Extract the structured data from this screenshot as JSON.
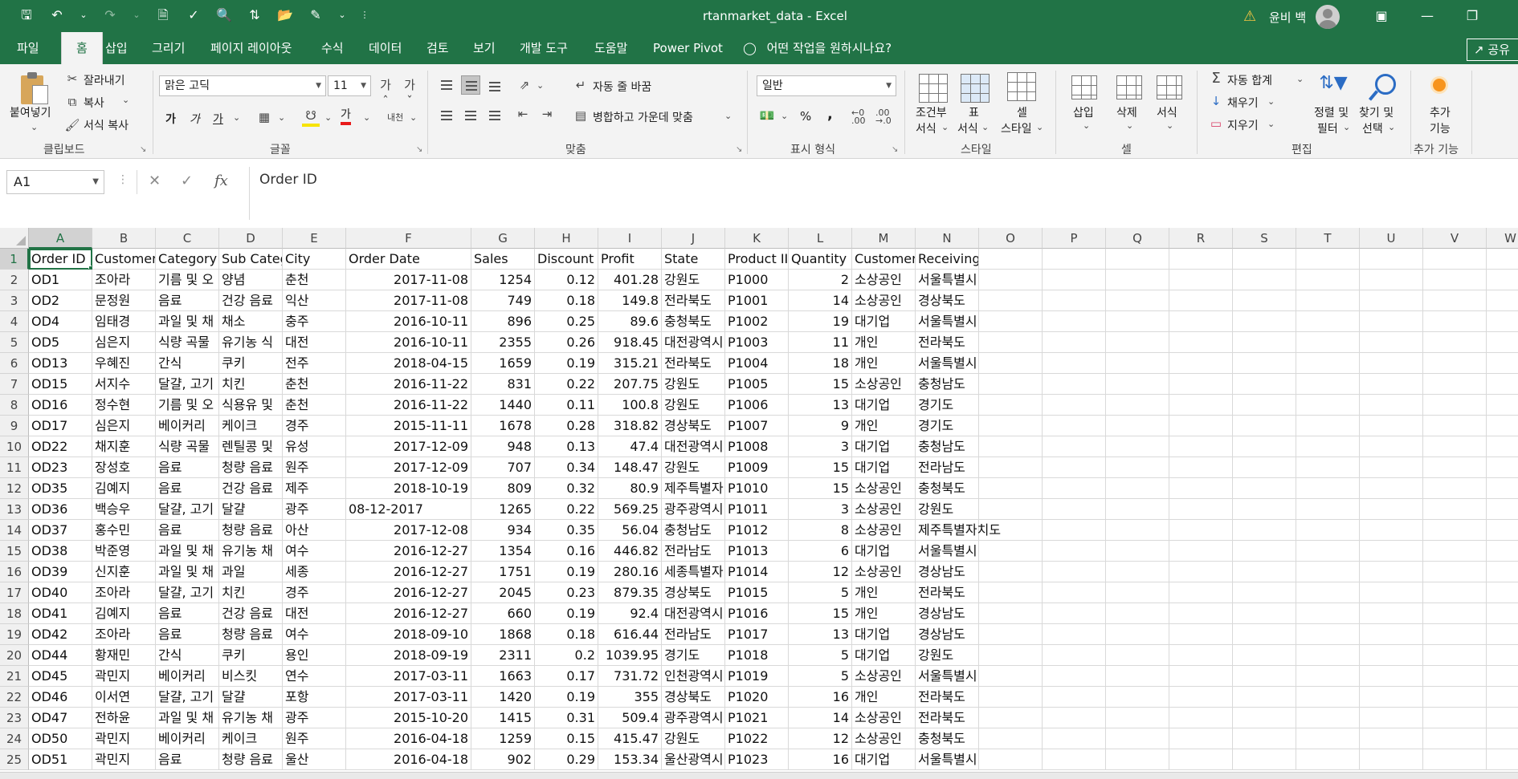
{
  "window": {
    "title": "rtanmarket_data  -  Excel",
    "user_name": "윤비 백"
  },
  "menu": {
    "tabs": [
      "파일",
      "홈",
      "삽입",
      "그리기",
      "페이지 레이아웃",
      "수식",
      "데이터",
      "검토",
      "보기",
      "개발 도구",
      "도움말",
      "Power Pivot"
    ],
    "active_tab": "홈",
    "tell_me": "어떤 작업을 원하시나요?",
    "share": "공유"
  },
  "ribbon": {
    "clipboard": {
      "paste": "붙여넣기",
      "cut": "잘라내기",
      "copy": "복사",
      "format_painter": "서식 복사",
      "group": "클립보드"
    },
    "font": {
      "name": "맑은 고딕",
      "size": "11",
      "bold": "가",
      "italic": "가",
      "underline": "가",
      "font_color_glyph": "가",
      "phonetic": "내천",
      "group": "글꼴"
    },
    "alignment": {
      "wrap_text": "자동 줄 바꿈",
      "merge_center": "병합하고 가운데 맞춤",
      "group": "맞춤"
    },
    "number": {
      "format": "일반",
      "percent": "%",
      "comma": ",",
      "group": "표시 형식"
    },
    "styles": {
      "conditional_line1": "조건부",
      "conditional_line2": "서식",
      "table_line1": "표",
      "table_line2": "서식",
      "cell_line1": "셀",
      "cell_line2": "스타일",
      "group": "스타일"
    },
    "cells": {
      "insert": "삽입",
      "delete": "삭제",
      "format": "서식",
      "group": "셀"
    },
    "editing": {
      "autosum": "자동 합계",
      "fill": "채우기",
      "clear": "지우기",
      "sort_line1": "정렬 및",
      "sort_line2": "필터",
      "find_line1": "찾기 및",
      "find_line2": "선택",
      "group": "편집"
    },
    "addins": {
      "label_line1": "추가",
      "label_line2": "기능",
      "group": "추가 기능"
    }
  },
  "formula_bar": {
    "name_box": "A1",
    "fx": "fx",
    "content": "Order ID"
  },
  "sheet": {
    "active_cell": "A1",
    "columns": [
      "A",
      "B",
      "C",
      "D",
      "E",
      "F",
      "G",
      "H",
      "I",
      "J",
      "K",
      "L",
      "M",
      "N",
      "O",
      "P",
      "Q",
      "R",
      "S",
      "T",
      "U",
      "V",
      "W"
    ],
    "row_numbers": [
      "1",
      "2",
      "3",
      "4",
      "5",
      "6",
      "7",
      "8",
      "9",
      "10",
      "11",
      "12",
      "13",
      "14",
      "15",
      "16",
      "17",
      "18",
      "19",
      "20",
      "21",
      "22",
      "23",
      "24",
      "25"
    ],
    "headers": [
      "Order ID",
      "Customer",
      "Category",
      "Sub Categ",
      "City",
      "Order Date",
      "Sales",
      "Discount",
      "Profit",
      "State",
      "Product II",
      "Quantity",
      "Customer",
      "Receiving"
    ],
    "rows": [
      [
        "OD1",
        "조아라",
        "기름 및 오",
        "양념",
        "춘천",
        "2017-11-08",
        "1254",
        "0.12",
        "401.28",
        "강원도",
        "P1000",
        "2",
        "소상공인",
        "서울특별시"
      ],
      [
        "OD2",
        "문정원",
        "음료",
        "건강 음료",
        "익산",
        "2017-11-08",
        "749",
        "0.18",
        "149.8",
        "전라북도",
        "P1001",
        "14",
        "소상공인",
        "경상북도"
      ],
      [
        "OD4",
        "임태경",
        "과일 및 채",
        "채소",
        "충주",
        "2016-10-11",
        "896",
        "0.25",
        "89.6",
        "충청북도",
        "P1002",
        "19",
        "대기업",
        "서울특별시"
      ],
      [
        "OD5",
        "심은지",
        "식량 곡물",
        "유기농 식",
        "대전",
        "2016-10-11",
        "2355",
        "0.26",
        "918.45",
        "대전광역시",
        "P1003",
        "11",
        "개인",
        "전라북도"
      ],
      [
        "OD13",
        "우혜진",
        "간식",
        "쿠키",
        "전주",
        "2018-04-15",
        "1659",
        "0.19",
        "315.21",
        "전라북도",
        "P1004",
        "18",
        "개인",
        "서울특별시"
      ],
      [
        "OD15",
        "서지수",
        "달걀, 고기",
        "치킨",
        "춘천",
        "2016-11-22",
        "831",
        "0.22",
        "207.75",
        "강원도",
        "P1005",
        "15",
        "소상공인",
        "충청남도"
      ],
      [
        "OD16",
        "정수현",
        "기름 및 오",
        "식용유 및",
        "춘천",
        "2016-11-22",
        "1440",
        "0.11",
        "100.8",
        "강원도",
        "P1006",
        "13",
        "대기업",
        "경기도"
      ],
      [
        "OD17",
        "심은지",
        "베이커리",
        "케이크",
        "경주",
        "2015-11-11",
        "1678",
        "0.28",
        "318.82",
        "경상북도",
        "P1007",
        "9",
        "개인",
        "경기도"
      ],
      [
        "OD22",
        "채지훈",
        "식량 곡물",
        "렌틸콩 및",
        "유성",
        "2017-12-09",
        "948",
        "0.13",
        "47.4",
        "대전광역시",
        "P1008",
        "3",
        "대기업",
        "충청남도"
      ],
      [
        "OD23",
        "장성호",
        "음료",
        "청량 음료",
        "원주",
        "2017-12-09",
        "707",
        "0.34",
        "148.47",
        "강원도",
        "P1009",
        "15",
        "대기업",
        "전라남도"
      ],
      [
        "OD35",
        "김예지",
        "음료",
        "건강 음료",
        "제주",
        "2018-10-19",
        "809",
        "0.32",
        "80.9",
        "제주특별자",
        "P1010",
        "15",
        "소상공인",
        "충청북도"
      ],
      [
        "OD36",
        "백승우",
        "달걀, 고기",
        "달걀",
        "광주",
        "08-12-2017",
        "1265",
        "0.22",
        "569.25",
        "광주광역시",
        "P1011",
        "3",
        "소상공인",
        "강원도"
      ],
      [
        "OD37",
        "홍수민",
        "음료",
        "청량 음료",
        "아산",
        "2017-12-08",
        "934",
        "0.35",
        "56.04",
        "충청남도",
        "P1012",
        "8",
        "소상공인",
        "제주특별자치도"
      ],
      [
        "OD38",
        "박준영",
        "과일 및 채",
        "유기농 채",
        "여수",
        "2016-12-27",
        "1354",
        "0.16",
        "446.82",
        "전라남도",
        "P1013",
        "6",
        "대기업",
        "서울특별시"
      ],
      [
        "OD39",
        "신지훈",
        "과일 및 채",
        "과일",
        "세종",
        "2016-12-27",
        "1751",
        "0.19",
        "280.16",
        "세종특별자",
        "P1014",
        "12",
        "소상공인",
        "경상남도"
      ],
      [
        "OD40",
        "조아라",
        "달걀, 고기",
        "치킨",
        "경주",
        "2016-12-27",
        "2045",
        "0.23",
        "879.35",
        "경상북도",
        "P1015",
        "5",
        "개인",
        "전라북도"
      ],
      [
        "OD41",
        "김예지",
        "음료",
        "건강 음료",
        "대전",
        "2016-12-27",
        "660",
        "0.19",
        "92.4",
        "대전광역시",
        "P1016",
        "15",
        "개인",
        "경상남도"
      ],
      [
        "OD42",
        "조아라",
        "음료",
        "청량 음료",
        "여수",
        "2018-09-10",
        "1868",
        "0.18",
        "616.44",
        "전라남도",
        "P1017",
        "13",
        "대기업",
        "경상남도"
      ],
      [
        "OD44",
        "황재민",
        "간식",
        "쿠키",
        "용인",
        "2018-09-19",
        "2311",
        "0.2",
        "1039.95",
        "경기도",
        "P1018",
        "5",
        "대기업",
        "강원도"
      ],
      [
        "OD45",
        "곽민지",
        "베이커리",
        "비스킷",
        "연수",
        "2017-03-11",
        "1663",
        "0.17",
        "731.72",
        "인천광역시",
        "P1019",
        "5",
        "소상공인",
        "서울특별시"
      ],
      [
        "OD46",
        "이서연",
        "달걀, 고기",
        "달걀",
        "포항",
        "2017-03-11",
        "1420",
        "0.19",
        "355",
        "경상북도",
        "P1020",
        "16",
        "개인",
        "전라북도"
      ],
      [
        "OD47",
        "전하윤",
        "과일 및 채",
        "유기농 채",
        "광주",
        "2015-10-20",
        "1415",
        "0.31",
        "509.4",
        "광주광역시",
        "P1021",
        "14",
        "소상공인",
        "전라북도"
      ],
      [
        "OD50",
        "곽민지",
        "베이커리",
        "케이크",
        "원주",
        "2016-04-18",
        "1259",
        "0.15",
        "415.47",
        "강원도",
        "P1022",
        "12",
        "소상공인",
        "충청북도"
      ],
      [
        "OD51",
        "곽민지",
        "음료",
        "청량 음료",
        "울산",
        "2016-04-18",
        "902",
        "0.29",
        "153.34",
        "울산광역시",
        "P1023",
        "16",
        "대기업",
        "서울특별시"
      ]
    ],
    "numeric_columns": [
      6,
      7,
      8,
      11
    ],
    "right_aligned_dates": true
  }
}
